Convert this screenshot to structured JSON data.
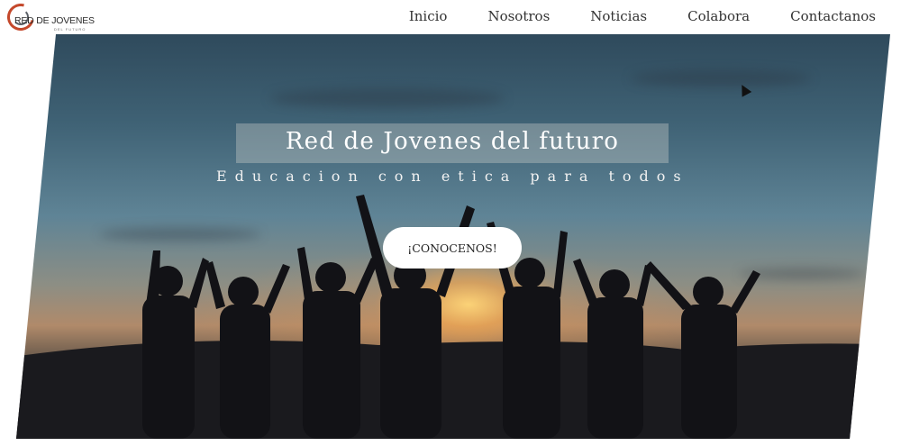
{
  "logo": {
    "text": "RED DE JOVENES",
    "subtext": "DEL FUTURO"
  },
  "nav": {
    "items": [
      {
        "label": "Inicio"
      },
      {
        "label": "Nosotros"
      },
      {
        "label": "Noticias"
      },
      {
        "label": "Colabora"
      },
      {
        "label": "Contactanos"
      }
    ]
  },
  "hero": {
    "title": "Red de Jovenes del futuro",
    "subtitle": "Educacion con etica para todos",
    "cta_label": "¡CONOCENOS!"
  },
  "colors": {
    "accent": "#c4482b",
    "nav_text": "#333333",
    "button_bg": "#ffffff"
  },
  "icons": {
    "cursor": "mouse-pointer-icon"
  }
}
